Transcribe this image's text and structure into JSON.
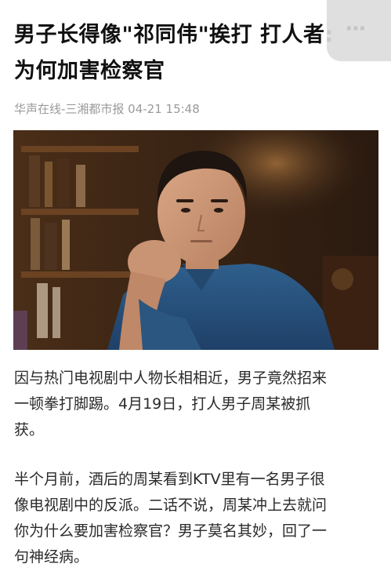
{
  "headline": {
    "line1": "男子长得像\"祁同伟\"挨打 打人者:",
    "line2": "为何加害检察官"
  },
  "meta": {
    "source": "华声在线-三湘都市报 04-21 15:48"
  },
  "overlay_button": {
    "icon": "more-icon"
  },
  "photo": {
    "subject": "man-portrait"
  },
  "paragraphs": [
    {
      "lines": [
        "因与热门电视剧中人物长相相近，男子竟然招来",
        "一顿拳打脚踢。4月19日，打人男子周某被抓",
        "获。"
      ]
    },
    {
      "lines": [
        "半个月前，酒后的周某看到KTV里有一名男子很",
        "像电视剧中的反派。二话不说，周某冲上去就问",
        "你为什么要加害检察官？男子莫名其妙，回了一",
        "句神经病。"
      ]
    }
  ]
}
